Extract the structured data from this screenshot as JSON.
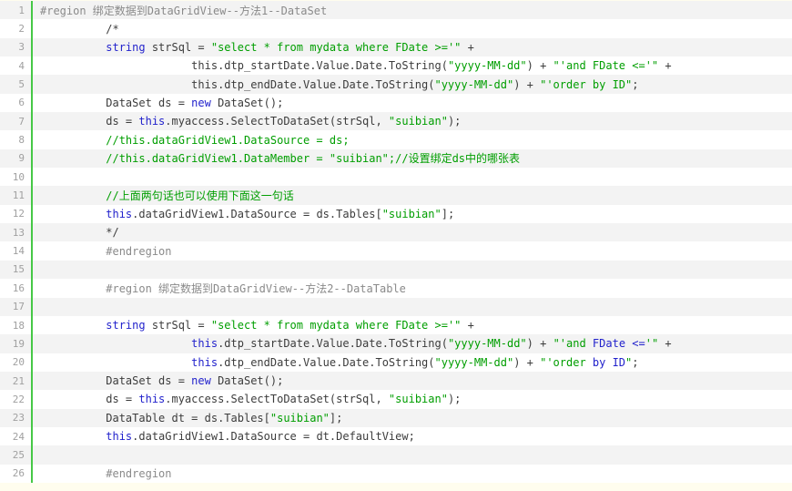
{
  "app": {
    "description_label": "C# code snippet viewer with line numbers",
    "language_label": "csharp"
  },
  "theme": {
    "page_background": "#FFFDEE",
    "row_odd_background": "#F3F3F3",
    "row_even_background": "#FFFFFF",
    "gutter_separator_green": "#46C846",
    "gutter_number_color": "#A0A0A0",
    "token_colors": {
      "d": "#3C3C3C",
      "k": "#2222CC",
      "s": "#009E00",
      "c": "#009E00",
      "p": "#8A8A8A"
    }
  },
  "code_block": {
    "lines": [
      {
        "num": "1",
        "tokens": [
          {
            "c": "p",
            "t": "#region 绑定数据到DataGridView--方法1--DataSet"
          }
        ]
      },
      {
        "num": "2",
        "tokens": [
          {
            "c": "d",
            "t": "          /*"
          }
        ]
      },
      {
        "num": "3",
        "tokens": [
          {
            "c": "d",
            "t": "          "
          },
          {
            "c": "k",
            "t": "string"
          },
          {
            "c": "d",
            "t": " strSql = "
          },
          {
            "c": "s",
            "t": "\"select * from mydata where FDate >='\""
          },
          {
            "c": "d",
            "t": " +"
          }
        ]
      },
      {
        "num": "4",
        "tokens": [
          {
            "c": "d",
            "t": "                       this.dtp_startDate.Value.Date.ToString("
          },
          {
            "c": "s",
            "t": "\"yyyy-MM-dd\""
          },
          {
            "c": "d",
            "t": ") + "
          },
          {
            "c": "s",
            "t": "\"'and FDate <='\""
          },
          {
            "c": "d",
            "t": " +"
          }
        ]
      },
      {
        "num": "5",
        "tokens": [
          {
            "c": "d",
            "t": "                       this.dtp_endDate.Value.Date.ToString("
          },
          {
            "c": "s",
            "t": "\"yyyy-MM-dd\""
          },
          {
            "c": "d",
            "t": ") + "
          },
          {
            "c": "s",
            "t": "\"'order by ID\""
          },
          {
            "c": "d",
            "t": ";"
          }
        ]
      },
      {
        "num": "6",
        "tokens": [
          {
            "c": "d",
            "t": "          DataSet ds = "
          },
          {
            "c": "k",
            "t": "new"
          },
          {
            "c": "d",
            "t": " DataSet();"
          }
        ]
      },
      {
        "num": "7",
        "tokens": [
          {
            "c": "d",
            "t": "          ds = "
          },
          {
            "c": "k",
            "t": "this"
          },
          {
            "c": "d",
            "t": ".myaccess.SelectToDataSet(strSql, "
          },
          {
            "c": "s",
            "t": "\"suibian\""
          },
          {
            "c": "d",
            "t": ");"
          }
        ]
      },
      {
        "num": "8",
        "tokens": [
          {
            "c": "c",
            "t": "          //this.dataGridView1.DataSource = ds;"
          }
        ]
      },
      {
        "num": "9",
        "tokens": [
          {
            "c": "c",
            "t": "          //this.dataGridView1.DataMember = \"suibian\";//设置绑定ds中的哪张表"
          }
        ]
      },
      {
        "num": "10",
        "tokens": []
      },
      {
        "num": "11",
        "tokens": [
          {
            "c": "c",
            "t": "          //上面两句话也可以使用下面这一句话"
          }
        ]
      },
      {
        "num": "12",
        "tokens": [
          {
            "c": "d",
            "t": "          "
          },
          {
            "c": "k",
            "t": "this"
          },
          {
            "c": "d",
            "t": ".dataGridView1.DataSource = ds.Tables["
          },
          {
            "c": "s",
            "t": "\"suibian\""
          },
          {
            "c": "d",
            "t": "];"
          }
        ]
      },
      {
        "num": "13",
        "tokens": [
          {
            "c": "d",
            "t": "          */"
          }
        ]
      },
      {
        "num": "14",
        "tokens": [
          {
            "c": "p",
            "t": "          #endregion"
          }
        ]
      },
      {
        "num": "15",
        "tokens": []
      },
      {
        "num": "16",
        "tokens": [
          {
            "c": "p",
            "t": "          #region 绑定数据到DataGridView--方法2--DataTable"
          }
        ]
      },
      {
        "num": "17",
        "tokens": []
      },
      {
        "num": "18",
        "tokens": [
          {
            "c": "d",
            "t": "          "
          },
          {
            "c": "k",
            "t": "string"
          },
          {
            "c": "d",
            "t": " strSql = "
          },
          {
            "c": "s",
            "t": "\"select * from mydata where FDate >='\""
          },
          {
            "c": "d",
            "t": " +"
          }
        ]
      },
      {
        "num": "19",
        "tokens": [
          {
            "c": "d",
            "t": "                       "
          },
          {
            "c": "k",
            "t": "this"
          },
          {
            "c": "d",
            "t": ".dtp_startDate.Value.Date.ToString("
          },
          {
            "c": "s",
            "t": "\"yyyy-MM-dd\""
          },
          {
            "c": "d",
            "t": ") + "
          },
          {
            "c": "s",
            "t": "\"'and "
          },
          {
            "c": "k",
            "t": "FDate <="
          },
          {
            "c": "s",
            "t": "'\""
          },
          {
            "c": "d",
            "t": " +"
          }
        ]
      },
      {
        "num": "20",
        "tokens": [
          {
            "c": "d",
            "t": "                       "
          },
          {
            "c": "k",
            "t": "this"
          },
          {
            "c": "d",
            "t": ".dtp_endDate.Value.Date.ToString("
          },
          {
            "c": "s",
            "t": "\"yyyy-MM-dd\""
          },
          {
            "c": "d",
            "t": ") + "
          },
          {
            "c": "s",
            "t": "\"'order "
          },
          {
            "c": "k",
            "t": "by ID"
          },
          {
            "c": "s",
            "t": "\""
          },
          {
            "c": "d",
            "t": ";"
          }
        ]
      },
      {
        "num": "21",
        "tokens": [
          {
            "c": "d",
            "t": "          DataSet ds = "
          },
          {
            "c": "k",
            "t": "new"
          },
          {
            "c": "d",
            "t": " DataSet();"
          }
        ]
      },
      {
        "num": "22",
        "tokens": [
          {
            "c": "d",
            "t": "          ds = "
          },
          {
            "c": "k",
            "t": "this"
          },
          {
            "c": "d",
            "t": ".myaccess.SelectToDataSet(strSql, "
          },
          {
            "c": "s",
            "t": "\"suibian\""
          },
          {
            "c": "d",
            "t": ");"
          }
        ]
      },
      {
        "num": "23",
        "tokens": [
          {
            "c": "d",
            "t": "          DataTable dt = ds.Tables["
          },
          {
            "c": "s",
            "t": "\"suibian\""
          },
          {
            "c": "d",
            "t": "];"
          }
        ]
      },
      {
        "num": "24",
        "tokens": [
          {
            "c": "d",
            "t": "          "
          },
          {
            "c": "k",
            "t": "this"
          },
          {
            "c": "d",
            "t": ".dataGridView1.DataSource = dt.DefaultView;"
          }
        ]
      },
      {
        "num": "25",
        "tokens": []
      },
      {
        "num": "26",
        "tokens": [
          {
            "c": "p",
            "t": "          #endregion"
          }
        ]
      }
    ]
  }
}
